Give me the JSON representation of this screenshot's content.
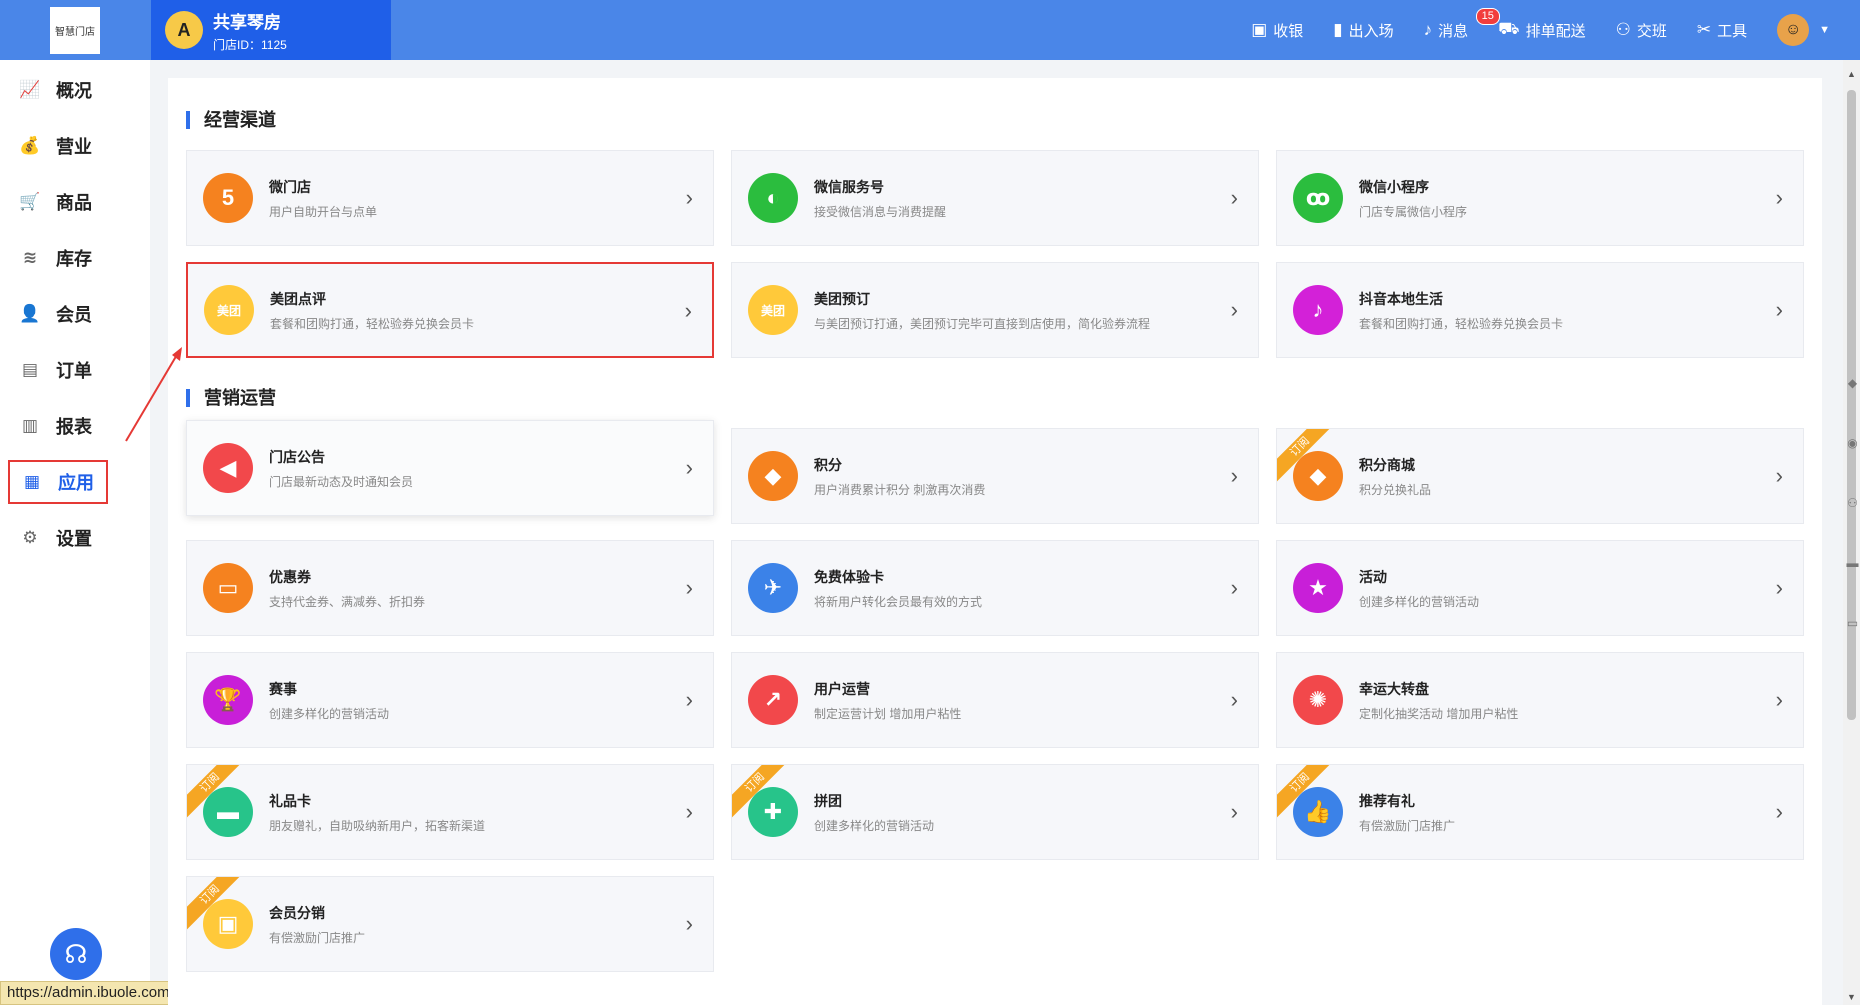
{
  "header": {
    "logo_text": "智慧门店",
    "store_avatar": "A",
    "store_name": "共享琴房",
    "store_id": "门店ID：1125",
    "menu": [
      {
        "label": "收银",
        "icon": "cashier-icon",
        "glyph": "▣"
      },
      {
        "label": "出入场",
        "icon": "door-icon",
        "glyph": "▮"
      },
      {
        "label": "消息",
        "icon": "bell-icon",
        "glyph": "♪",
        "badge": "15"
      },
      {
        "label": "排单配送",
        "icon": "delivery-icon",
        "glyph": "⛟"
      },
      {
        "label": "交班",
        "icon": "handover-icon",
        "glyph": "⚇"
      },
      {
        "label": "工具",
        "icon": "tools-icon",
        "glyph": "✂"
      }
    ]
  },
  "sidebar": {
    "items": [
      {
        "label": "概况",
        "icon": "chart-icon",
        "glyph": "📈"
      },
      {
        "label": "营业",
        "icon": "moneybag-icon",
        "glyph": "💰"
      },
      {
        "label": "商品",
        "icon": "cart-icon",
        "glyph": "🛒"
      },
      {
        "label": "库存",
        "icon": "layers-icon",
        "glyph": "≋"
      },
      {
        "label": "会员",
        "icon": "member-icon",
        "glyph": "👤"
      },
      {
        "label": "订单",
        "icon": "order-icon",
        "glyph": "▤"
      },
      {
        "label": "报表",
        "icon": "bar-chart-icon",
        "glyph": "▥"
      },
      {
        "label": "应用",
        "icon": "apps-icon",
        "glyph": "▦"
      },
      {
        "label": "设置",
        "icon": "settings-icon",
        "glyph": "⚙"
      }
    ],
    "status_url": "https://admin.ibuole.com/#/markets"
  },
  "sections": [
    {
      "title": "经营渠道"
    },
    {
      "title": "营销运营"
    }
  ],
  "ribbon_text": "订阅",
  "cards": [
    {
      "title": "微门店",
      "desc": "用户自助开台与点单",
      "glyph": "5",
      "color": "#f5821f",
      "icon": "html5-icon"
    },
    {
      "title": "微信服务号",
      "desc": "接受微信消息与消费提醒",
      "glyph": "◐",
      "color": "#2bbd3e",
      "icon": "wechat-icon"
    },
    {
      "title": "微信小程序",
      "desc": "门店专属微信小程序",
      "glyph": "ꝏ",
      "color": "#2bbd3e",
      "icon": "miniprogram-icon"
    },
    {
      "title": "美团点评",
      "desc": "套餐和团购打通，轻松验券兑换会员卡",
      "glyph": "美团",
      "color": "#ffc93a",
      "icon": "meituan-icon"
    },
    {
      "title": "美团预订",
      "desc": "与美团预订打通，美团预订完毕可直接到店使用，简化验券流程",
      "glyph": "美团",
      "color": "#ffc93a",
      "icon": "meituan-booking-icon"
    },
    {
      "title": "抖音本地生活",
      "desc": "套餐和团购打通，轻松验券兑换会员卡",
      "glyph": "♪",
      "color": "#d321d8",
      "icon": "douyin-icon"
    },
    {
      "title": "门店公告",
      "desc": "门店最新动态及时通知会员",
      "glyph": "◀",
      "color": "#f2484b",
      "icon": "megaphone-icon"
    },
    {
      "title": "积分",
      "desc": "用户消费累计积分 刺激再次消费",
      "glyph": "◆",
      "color": "#f5821f",
      "icon": "points-icon"
    },
    {
      "title": "积分商城",
      "desc": "积分兑换礼品",
      "glyph": "◆",
      "color": "#f5821f",
      "icon": "points-mall-icon"
    },
    {
      "title": "优惠券",
      "desc": "支持代金券、满减券、折扣券",
      "glyph": "▭",
      "color": "#f5821f",
      "icon": "coupon-icon"
    },
    {
      "title": "免费体验卡",
      "desc": "将新用户转化会员最有效的方式",
      "glyph": "✈",
      "color": "#3b82e8",
      "icon": "trial-card-icon"
    },
    {
      "title": "活动",
      "desc": "创建多样化的营销活动",
      "glyph": "★",
      "color": "#c81fd8",
      "icon": "activity-icon"
    },
    {
      "title": "赛事",
      "desc": "创建多样化的营销活动",
      "glyph": "🏆",
      "color": "#c81fd8",
      "icon": "trophy-icon"
    },
    {
      "title": "用户运营",
      "desc": "制定运营计划 增加用户粘性",
      "glyph": "↗",
      "color": "#f2484b",
      "icon": "user-operation-icon"
    },
    {
      "title": "幸运大转盘",
      "desc": "定制化抽奖活动 增加用户粘性",
      "glyph": "✺",
      "color": "#f2484b",
      "icon": "lucky-wheel-icon"
    },
    {
      "title": "礼品卡",
      "desc": "朋友赠礼，自助吸纳新用户，拓客新渠道",
      "glyph": "▬",
      "color": "#27c48a",
      "icon": "gift-card-icon"
    },
    {
      "title": "拼团",
      "desc": "创建多样化的营销活动",
      "glyph": "✚",
      "color": "#27c48a",
      "icon": "group-buy-icon"
    },
    {
      "title": "推荐有礼",
      "desc": "有偿激励门店推广",
      "glyph": "👍",
      "color": "#3b82e8",
      "icon": "thumbs-up-icon"
    },
    {
      "title": "会员分销",
      "desc": "有偿激励门店推广",
      "glyph": "▣",
      "color": "#ffc93a",
      "icon": "distribution-icon"
    }
  ]
}
